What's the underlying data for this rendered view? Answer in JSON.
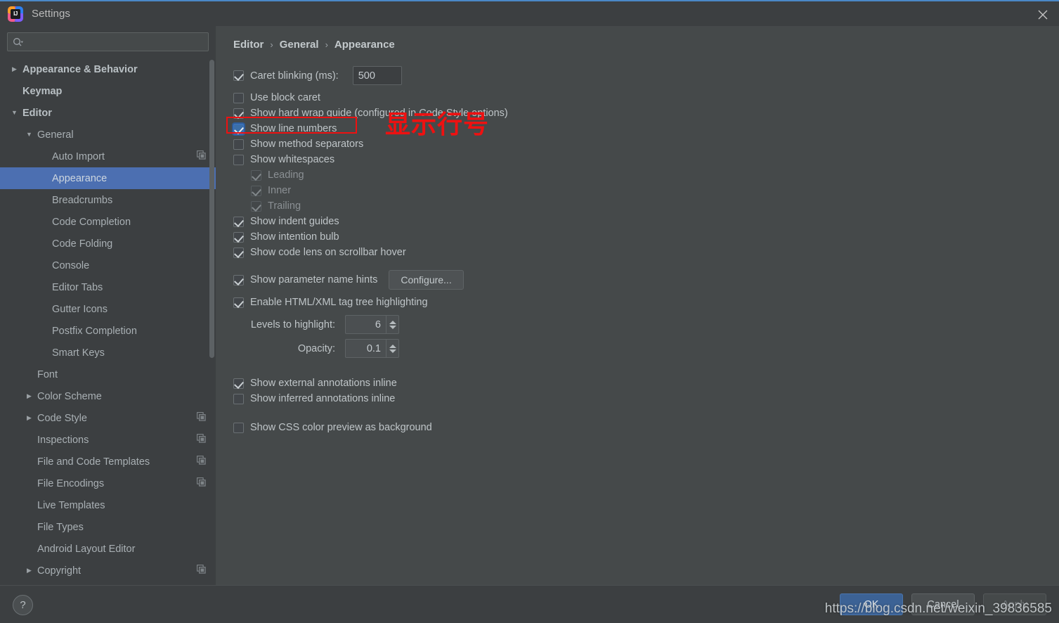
{
  "window": {
    "title": "Settings",
    "logo_text": "IJ",
    "close_label": "✕"
  },
  "search": {
    "value": "",
    "placeholder": ""
  },
  "sidebar": {
    "items": [
      {
        "label": "Appearance & Behavior",
        "indent": 0,
        "arrow": "collapsed",
        "bold": true,
        "selected": false,
        "copy": false
      },
      {
        "label": "Keymap",
        "indent": 0,
        "arrow": "none",
        "bold": true,
        "selected": false,
        "copy": false
      },
      {
        "label": "Editor",
        "indent": 0,
        "arrow": "expanded",
        "bold": true,
        "selected": false,
        "copy": false
      },
      {
        "label": "General",
        "indent": 1,
        "arrow": "expanded",
        "bold": false,
        "selected": false,
        "copy": false
      },
      {
        "label": "Auto Import",
        "indent": 2,
        "arrow": "none",
        "bold": false,
        "selected": false,
        "copy": true
      },
      {
        "label": "Appearance",
        "indent": 2,
        "arrow": "none",
        "bold": false,
        "selected": true,
        "copy": false
      },
      {
        "label": "Breadcrumbs",
        "indent": 2,
        "arrow": "none",
        "bold": false,
        "selected": false,
        "copy": false
      },
      {
        "label": "Code Completion",
        "indent": 2,
        "arrow": "none",
        "bold": false,
        "selected": false,
        "copy": false
      },
      {
        "label": "Code Folding",
        "indent": 2,
        "arrow": "none",
        "bold": false,
        "selected": false,
        "copy": false
      },
      {
        "label": "Console",
        "indent": 2,
        "arrow": "none",
        "bold": false,
        "selected": false,
        "copy": false
      },
      {
        "label": "Editor Tabs",
        "indent": 2,
        "arrow": "none",
        "bold": false,
        "selected": false,
        "copy": false
      },
      {
        "label": "Gutter Icons",
        "indent": 2,
        "arrow": "none",
        "bold": false,
        "selected": false,
        "copy": false
      },
      {
        "label": "Postfix Completion",
        "indent": 2,
        "arrow": "none",
        "bold": false,
        "selected": false,
        "copy": false
      },
      {
        "label": "Smart Keys",
        "indent": 2,
        "arrow": "none",
        "bold": false,
        "selected": false,
        "copy": false
      },
      {
        "label": "Font",
        "indent": 1,
        "arrow": "none",
        "bold": false,
        "selected": false,
        "copy": false
      },
      {
        "label": "Color Scheme",
        "indent": 1,
        "arrow": "collapsed",
        "bold": false,
        "selected": false,
        "copy": false
      },
      {
        "label": "Code Style",
        "indent": 1,
        "arrow": "collapsed",
        "bold": false,
        "selected": false,
        "copy": true
      },
      {
        "label": "Inspections",
        "indent": 1,
        "arrow": "none",
        "bold": false,
        "selected": false,
        "copy": true
      },
      {
        "label": "File and Code Templates",
        "indent": 1,
        "arrow": "none",
        "bold": false,
        "selected": false,
        "copy": true
      },
      {
        "label": "File Encodings",
        "indent": 1,
        "arrow": "none",
        "bold": false,
        "selected": false,
        "copy": true
      },
      {
        "label": "Live Templates",
        "indent": 1,
        "arrow": "none",
        "bold": false,
        "selected": false,
        "copy": false
      },
      {
        "label": "File Types",
        "indent": 1,
        "arrow": "none",
        "bold": false,
        "selected": false,
        "copy": false
      },
      {
        "label": "Android Layout Editor",
        "indent": 1,
        "arrow": "none",
        "bold": false,
        "selected": false,
        "copy": false
      },
      {
        "label": "Copyright",
        "indent": 1,
        "arrow": "collapsed",
        "bold": false,
        "selected": false,
        "copy": true
      }
    ]
  },
  "breadcrumb": {
    "part1": "Editor",
    "sep1": "›",
    "part2": "General",
    "sep2": "›",
    "part3": "Appearance"
  },
  "settings": {
    "caret_blinking_label": "Caret blinking (ms):",
    "caret_blinking_value": "500",
    "use_block_caret": "Use block caret",
    "show_hard_wrap_guide": "Show hard wrap guide (configured in Code Style options)",
    "show_line_numbers": "Show line numbers",
    "show_method_separators": "Show method separators",
    "show_whitespaces": "Show whitespaces",
    "leading": "Leading",
    "inner": "Inner",
    "trailing": "Trailing",
    "show_indent_guides": "Show indent guides",
    "show_intention_bulb": "Show intention bulb",
    "show_code_lens": "Show code lens on scrollbar hover",
    "show_parameter_name_hints": "Show parameter name hints",
    "configure_button": "Configure...",
    "enable_html_xml": "Enable HTML/XML tag tree highlighting",
    "levels_label": "Levels to highlight:",
    "levels_value": "6",
    "opacity_label": "Opacity:",
    "opacity_value": "0.1",
    "show_external_annotations": "Show external annotations inline",
    "show_inferred_annotations": "Show inferred annotations inline",
    "show_css_color_preview": "Show CSS color preview as background"
  },
  "annotation": {
    "text": "显示行号",
    "color": "#ee1111"
  },
  "footer": {
    "help_label": "?",
    "ok": "OK",
    "cancel": "Cancel",
    "apply": "Apply"
  },
  "watermark": {
    "text": "https://blog.csdn.net/weixin_39836585"
  },
  "colors": {
    "selection": "#4c6fb1",
    "panel_bg": "#45494a",
    "sidebar_bg": "#3c3f41",
    "accent": "#3c6295",
    "annotation_red": "#ee1111"
  }
}
